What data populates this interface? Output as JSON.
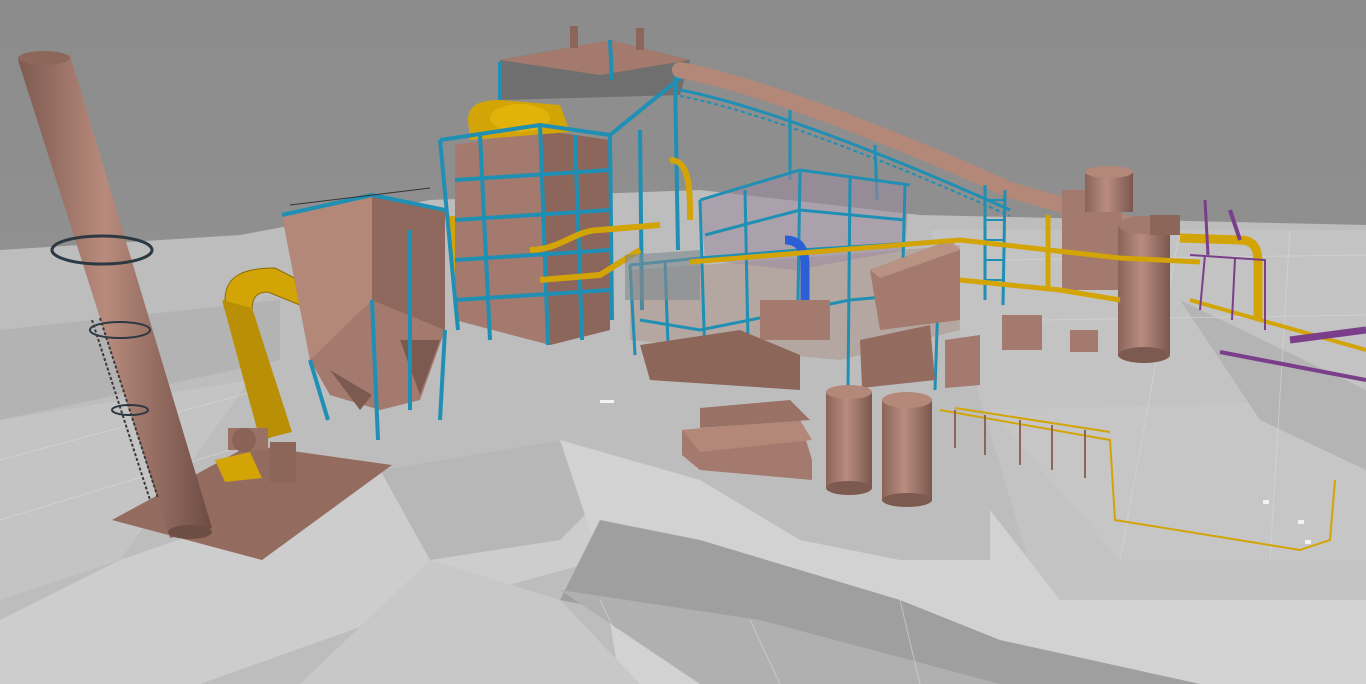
{
  "viewport": {
    "label": "",
    "view_mode": "3D plant model"
  },
  "colors": {
    "background": "#8d8d8d",
    "ground": "#c9c9c9",
    "ground_shade": "#a9a9a9",
    "equipment_brown": "#a37a6d",
    "equipment_brown_dark": "#7d5a50",
    "steel_structure": "#1f8fb4",
    "pipe_yellow": "#d3a406",
    "pipe_blue": "#2a5fd6",
    "pipe_purple": "#7a3e8a",
    "roof_gray": "#6f6f6f"
  },
  "objects": [
    "chimney-stack",
    "baghouse-filter",
    "boiler-structure",
    "conveyor-gallery",
    "turbine-hall-frame",
    "storage-tanks",
    "cooling-silos",
    "pipe-racks"
  ]
}
